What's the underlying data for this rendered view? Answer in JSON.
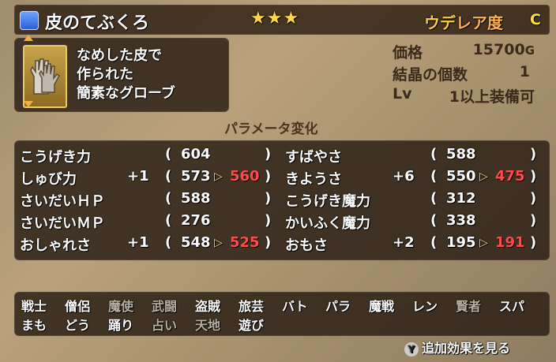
{
  "title": {
    "name": "皮のてぶくろ",
    "stars": "★★★",
    "rarity_prefix": "ウデ",
    "rarity_suffix": "レア度",
    "grade": "C"
  },
  "description": [
    "なめした皮で",
    "作られた",
    "簡素なグローブ"
  ],
  "info": {
    "price_label": "価格",
    "price_value": "15700",
    "price_unit": "G",
    "crystal_label": "結晶の個数",
    "crystal_value": "1",
    "level_label": "Lv",
    "level_value": "1以上装備可"
  },
  "param_header": "パラメータ変化",
  "stats_left": [
    {
      "name": "こうげき力",
      "mod": "",
      "base": "604",
      "new": ""
    },
    {
      "name": "しゅび力",
      "mod": "+1",
      "base": "573",
      "new": "560"
    },
    {
      "name": "さいだいＨＰ",
      "mod": "",
      "base": "588",
      "new": ""
    },
    {
      "name": "さいだいＭＰ",
      "mod": "",
      "base": "276",
      "new": ""
    },
    {
      "name": "おしゃれさ",
      "mod": "+1",
      "base": "548",
      "new": "525"
    }
  ],
  "stats_right": [
    {
      "name": "すばやさ",
      "mod": "",
      "base": "588",
      "new": ""
    },
    {
      "name": "きようさ",
      "mod": "+6",
      "base": "550",
      "new": "475"
    },
    {
      "name": "こうげき魔力",
      "mod": "",
      "base": "312",
      "new": ""
    },
    {
      "name": "かいふく魔力",
      "mod": "",
      "base": "338",
      "new": ""
    },
    {
      "name": "おもさ",
      "mod": "+2",
      "base": "195",
      "new": "191"
    }
  ],
  "jobs_row1": [
    "戦士",
    "僧侶",
    "魔使",
    "武闘",
    "盗賊",
    "旅芸",
    "バト",
    "パラ",
    "魔戦",
    "レン",
    "賢者",
    "スパ"
  ],
  "jobs_row2": [
    "まも",
    "どう",
    "踊り",
    "占い",
    "天地",
    "遊び"
  ],
  "footer": {
    "button": "Y",
    "label": "追加効果を見る"
  },
  "colors": {
    "increase": "#ff4b4b",
    "stars": "#ffd84a",
    "rarity": "#ffcc40"
  }
}
